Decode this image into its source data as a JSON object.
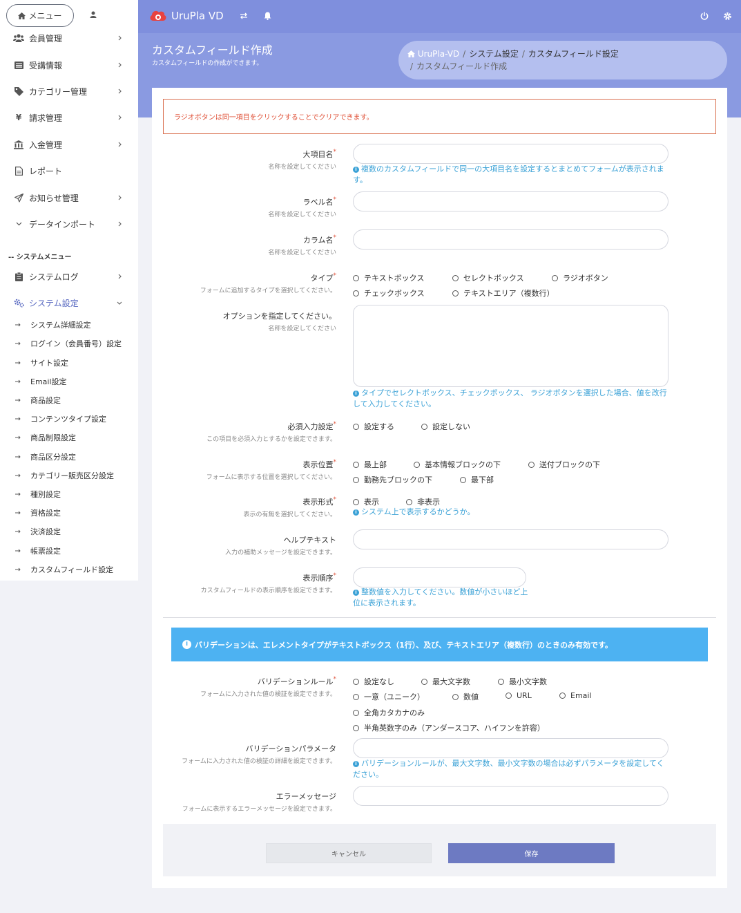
{
  "app": {
    "brand": "UruPla VD"
  },
  "sidebar": {
    "menu_button": "メニュー",
    "items": [
      {
        "label": "会員管理"
      },
      {
        "label": "受講情報"
      },
      {
        "label": "カテゴリー管理"
      },
      {
        "label": "請求管理"
      },
      {
        "label": "入金管理"
      },
      {
        "label": "レポート"
      },
      {
        "label": "お知らせ管理"
      },
      {
        "label": "データインポート"
      }
    ],
    "system_heading": "-- システムメニュー",
    "system_items": [
      {
        "label": "システムログ"
      },
      {
        "label": "システム設定"
      }
    ],
    "sub_items": [
      {
        "label": "システム詳細設定"
      },
      {
        "label": "ログイン（会員番号）設定"
      },
      {
        "label": "サイト設定"
      },
      {
        "label": "Email設定"
      },
      {
        "label": "商品設定"
      },
      {
        "label": "コンテンツタイプ設定"
      },
      {
        "label": "商品制限設定"
      },
      {
        "label": "商品区分設定"
      },
      {
        "label": "カテゴリー販売区分設定"
      },
      {
        "label": "種別設定"
      },
      {
        "label": "資格設定"
      },
      {
        "label": "決済設定"
      },
      {
        "label": "帳票設定"
      },
      {
        "label": "カスタムフィールド設定"
      }
    ]
  },
  "header": {
    "title": "カスタムフィールド作成",
    "subtitle": "カスタムフィールドの作成ができます。",
    "breadcrumb": [
      "UruPla-VD",
      "システム設定",
      "カスタムフィールド設定",
      "カスタムフィールド作成"
    ]
  },
  "form": {
    "alert": "ラジオボタンは同一項目をクリックすることでクリアできます。",
    "required_mark": "*",
    "major_item": {
      "label": "大項目名",
      "desc": "名称を設定してください",
      "value": "",
      "help": "複数のカスタムフィールドで同一の大項目名を設定するとまとめてフォームが表示されます。"
    },
    "label_name": {
      "label": "ラベル名",
      "desc": "名称を設定してください",
      "value": ""
    },
    "column_name": {
      "label": "カラム名",
      "desc": "名称を設定してください",
      "value": ""
    },
    "type": {
      "label": "タイプ",
      "desc": "フォームに追加するタイプを選択してください。",
      "options": [
        "テキストボックス",
        "セレクトボックス",
        "ラジオボタン",
        "チェックボックス",
        "テキストエリア（複数行）"
      ]
    },
    "options_field": {
      "label": "オプションを指定してください。",
      "desc": "名称を設定してください",
      "value": "",
      "help": "タイプでセレクトボックス、チェックボックス、 ラジオボタンを選択した場合、値を改行して入力してください。"
    },
    "required": {
      "label": "必須入力設定",
      "desc": "この項目を必須入力とするかを設定できます。",
      "options": [
        "設定する",
        "設定しない"
      ]
    },
    "position": {
      "label": "表示位置",
      "desc": "フォームに表示する位置を選択してください。",
      "options": [
        "最上部",
        "基本情報ブロックの下",
        "送付ブロックの下",
        "勤務先ブロックの下",
        "最下部"
      ]
    },
    "display": {
      "label": "表示形式",
      "desc": "表示の有無を選択してください。",
      "options": [
        "表示",
        "非表示"
      ],
      "help": "システム上で表示するかどうか。"
    },
    "help_text": {
      "label": "ヘルプテキスト",
      "desc": "入力の補助メッセージを設定できます。",
      "value": ""
    },
    "order": {
      "label": "表示順序",
      "desc": "カスタムフィールドの表示順序を設定できます。",
      "value": "",
      "help": "整数値を入力してください。数値が小さいほど上位に表示されます。"
    },
    "validation_info": "バリデーションは、エレメントタイプがテキストボックス（1行）、及び、テキストエリア（複数行）のときのみ有効です。",
    "validation_rule": {
      "label": "バリデーションルール",
      "desc": "フォームに入力された値の検証を設定できます。",
      "options": [
        "設定なし",
        "最大文字数",
        "最小文字数",
        "一意（ユニーク）",
        "数値",
        "URL",
        "Email",
        "全角カタカナのみ",
        "半角英数字のみ（アンダースコア、ハイフンを許容）"
      ]
    },
    "validation_param": {
      "label": "バリデーションパラメータ",
      "desc": "フォームに入力された値の検証の詳細を設定できます。",
      "value": "",
      "help": "バリデーションルールが、最大文字数、最小文字数の場合は必ずパラメータを設定してください。"
    },
    "error_message": {
      "label": "エラーメッセージ",
      "desc": "フォームに表示するエラーメッセージを設定できます。",
      "value": ""
    },
    "cancel_label": "キャンセル",
    "save_label": "保存"
  }
}
